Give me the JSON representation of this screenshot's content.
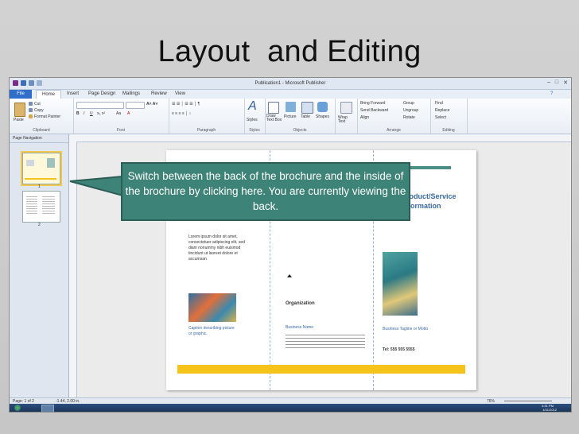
{
  "slide": {
    "title": "Layout  and Editing"
  },
  "window": {
    "title": "Publication1 - Microsoft Publisher",
    "minimize": "–",
    "maximize": "□",
    "close": "✕"
  },
  "tabs": [
    "File",
    "Home",
    "Insert",
    "Page Design",
    "Mailings",
    "Review",
    "View"
  ],
  "ribbon": {
    "clipboard": {
      "label": "Clipboard",
      "paste": "Paste",
      "cut": "Cut",
      "copy": "Copy",
      "format_painter": "Format Painter"
    },
    "font": {
      "label": "Font"
    },
    "paragraph": {
      "label": "Paragraph"
    },
    "styles": {
      "label": "Styles",
      "styles_btn": "Styles"
    },
    "objects": {
      "label": "Objects",
      "draw_text_box": "Draw Text Box",
      "picture": "Picture",
      "table": "Table",
      "shapes": "Shapes"
    },
    "wrap": {
      "label": "Wrap Text"
    },
    "arrange": {
      "label": "Arrange",
      "bring_forward": "Bring Forward",
      "send_backward": "Send Backward",
      "align": "Align",
      "group": "Group",
      "ungroup": "Ungroup",
      "rotate": "Rotate"
    },
    "editing": {
      "label": "Editing",
      "find": "Find",
      "replace": "Replace",
      "select": "Select"
    }
  },
  "nav": {
    "header": "Page Navigation",
    "pages": [
      "1",
      "2"
    ]
  },
  "document": {
    "heading_right": "Product/Service Information",
    "org_name": "Organization",
    "caption": "Caption describing picture or graphic.",
    "business_name": "Business Name",
    "business_tagline": "Business Tagline or Motto",
    "tel": "Tel: 555 555 5555",
    "lorem": "Lorem ipsum dolor sit amet, consectetuer adipiscing elit, sed diam nonummy nibh euismod tincidunt ut laoreet dolore et accumsan"
  },
  "callout": {
    "text": "Switch between the back of the brochure and the inside of the brochure by clicking here. You are currently viewing the back."
  },
  "status": {
    "page": "Page: 1 of 2",
    "position": "-1.44, 2.00 in.",
    "zoom": "76%"
  },
  "taskbar": {
    "time": "3:31 PM",
    "date": "1/31/2012"
  },
  "colors": {
    "callout_bg": "#3e8377",
    "file_tab": "#2f6ec9",
    "yellow_bar": "#f5c319",
    "thumb_selected": "#f2c94c"
  }
}
